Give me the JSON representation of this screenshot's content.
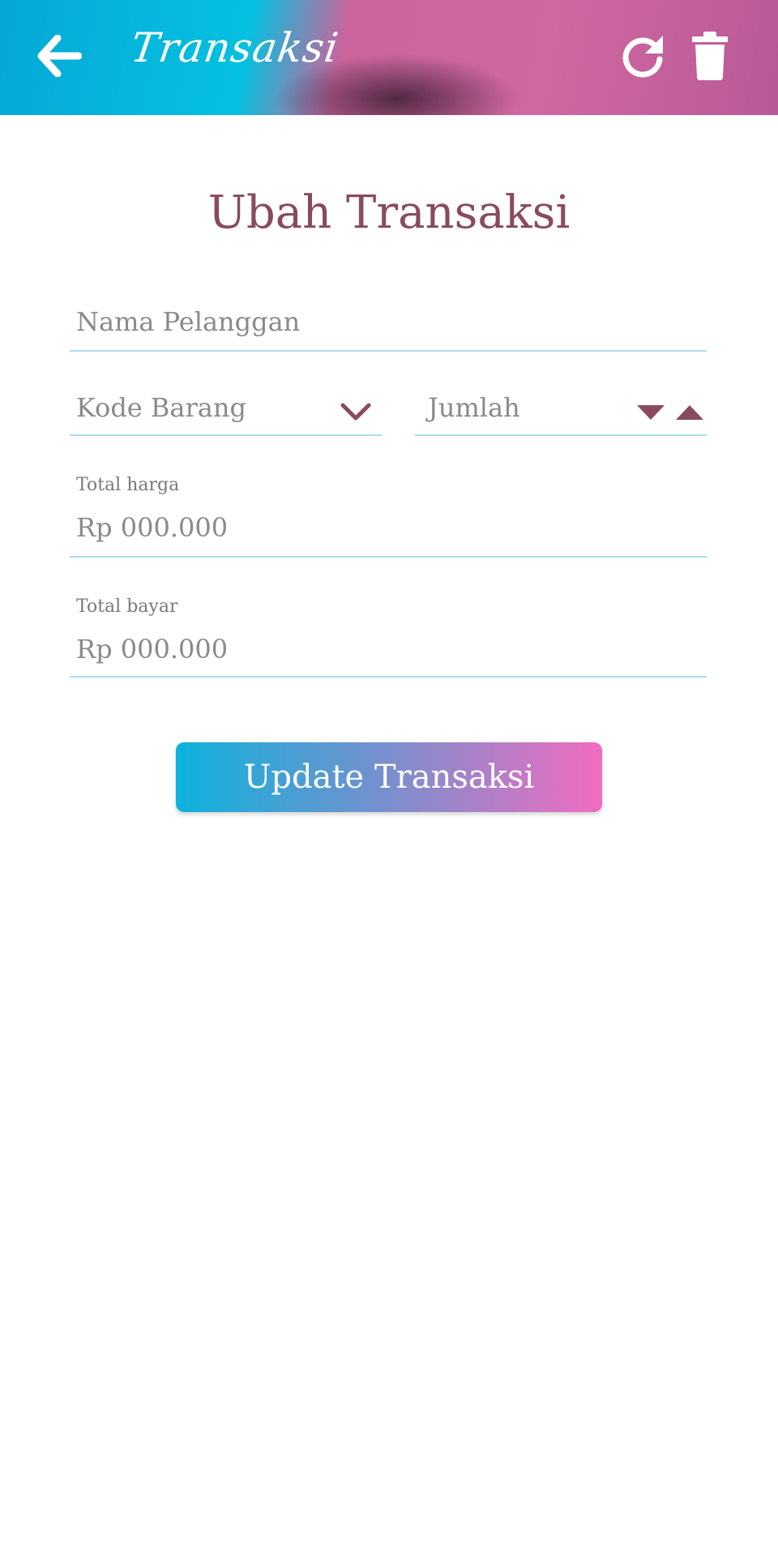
{
  "appbar": {
    "title": "Transaksi",
    "back_icon": "arrow-left-icon",
    "refresh_icon": "refresh-icon",
    "delete_icon": "trash-icon"
  },
  "form": {
    "heading": "Ubah Transaksi",
    "nama_pelanggan": {
      "placeholder": "Nama Pelanggan"
    },
    "kode_barang": {
      "placeholder": "Kode Barang",
      "icon": "chevron-down-icon"
    },
    "jumlah": {
      "placeholder": "Jumlah",
      "decrement_icon": "caret-down-icon",
      "increment_icon": "caret-up-icon"
    },
    "total_harga": {
      "label": "Total harga",
      "value": "Rp 000.000"
    },
    "total_bayar": {
      "label": "Total bayar",
      "value": "Rp 000.000"
    },
    "submit_label": "Update Transaksi"
  },
  "colors": {
    "accent": "#8a4a5e",
    "underline": "#a9dcec",
    "gradient_start": "#0cb2dc",
    "gradient_end": "#f06cc0"
  }
}
